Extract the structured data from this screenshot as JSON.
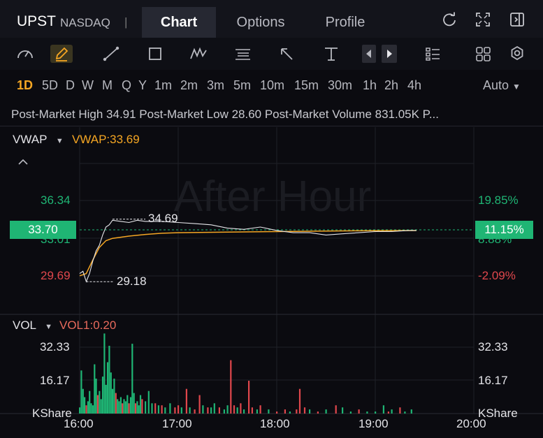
{
  "header": {
    "ticker": "UPST",
    "exchange": "NASDAQ",
    "separator": "|",
    "tabs": [
      {
        "label": "Chart",
        "active": true
      },
      {
        "label": "Options",
        "active": false
      },
      {
        "label": "Profile",
        "active": false
      }
    ]
  },
  "toolbar": {
    "icons": [
      "speedometer-icon",
      "pencil-icon",
      "trendline-icon",
      "rectangle-icon",
      "pattern-icon",
      "fibonacci-icon",
      "arrow-icon",
      "measure-icon",
      "prev-icon",
      "next-icon",
      "layout-icon",
      "grid-icon",
      "settings-icon"
    ]
  },
  "periods": {
    "items": [
      "1D",
      "5D",
      "D",
      "W",
      "M",
      "Q",
      "Y",
      "1m",
      "2m",
      "3m",
      "5m",
      "10m",
      "15m",
      "30m",
      "1h",
      "2h",
      "4h"
    ],
    "active": "1D",
    "mode": "Auto"
  },
  "info_line": "Post-Market High 34.91 Post-Market Low 28.60 Post-Market Volume 831.05K P...",
  "price_pane": {
    "indicator": "VWAP",
    "indicator_value": "VWAP:33.69",
    "watermark": "After Hour",
    "left_ticks": [
      "36.34",
      "33.01",
      "29.69"
    ],
    "right_ticks": [
      "19.85%",
      "8.88%",
      "-2.09%"
    ],
    "current_price": "33.70",
    "current_pct": "11.15%",
    "high_label": "34.69",
    "low_label": "29.18",
    "colors": {
      "up": "#1fb574",
      "down": "#e0474c",
      "vwap": "#f5a623",
      "price_line": "#e6e6ea"
    }
  },
  "volume_pane": {
    "indicator": "VOL",
    "indicator_value": "VOL1:0.20",
    "left_ticks": [
      "32.33",
      "16.17",
      "KShare"
    ],
    "right_ticks": [
      "32.33",
      "16.17",
      "KShare"
    ]
  },
  "x_axis": [
    "16:00",
    "17:00",
    "18:00",
    "19:00",
    "20:00"
  ],
  "chart_data": {
    "type": "line",
    "x_range": [
      "16:00",
      "20:00"
    ],
    "y_range": [
      28.6,
      37.5
    ],
    "price_series": {
      "x": [
        "16:00",
        "16:02",
        "16:04",
        "16:06",
        "16:08",
        "16:10",
        "16:12",
        "16:14",
        "16:16",
        "16:18",
        "16:20",
        "16:25",
        "16:30",
        "16:35",
        "16:40",
        "16:45",
        "16:50",
        "17:00",
        "17:10",
        "17:20",
        "17:30",
        "17:40",
        "17:50",
        "18:00",
        "18:10",
        "18:20",
        "18:30",
        "18:40",
        "18:50",
        "19:00",
        "19:10",
        "19:20",
        "19:25"
      ],
      "values": [
        29.9,
        30.1,
        29.2,
        29.9,
        31.0,
        31.9,
        32.4,
        33.3,
        34.0,
        34.2,
        34.6,
        34.5,
        34.4,
        34.6,
        34.5,
        34.5,
        34.5,
        34.4,
        34.3,
        34.2,
        33.9,
        33.8,
        34.0,
        33.7,
        33.5,
        33.5,
        33.3,
        33.4,
        33.5,
        33.6,
        33.6,
        33.7,
        33.7
      ]
    },
    "vwap_series": {
      "x": [
        "16:00",
        "16:04",
        "16:08",
        "16:12",
        "16:16",
        "16:20",
        "16:30",
        "16:40",
        "16:50",
        "17:00",
        "17:30",
        "18:00",
        "18:30",
        "19:00",
        "19:25"
      ],
      "values": [
        29.7,
        29.9,
        31.1,
        32.2,
        32.8,
        33.0,
        33.2,
        33.35,
        33.45,
        33.5,
        33.55,
        33.6,
        33.65,
        33.68,
        33.69
      ]
    },
    "volume": {
      "unit": "KShare",
      "y_range": [
        0,
        40
      ],
      "bars": [
        {
          "t": "16:00",
          "v": 3,
          "d": "up"
        },
        {
          "t": "16:01",
          "v": 21,
          "d": "up"
        },
        {
          "t": "16:02",
          "v": 12,
          "d": "up"
        },
        {
          "t": "16:03",
          "v": 8,
          "d": "up"
        },
        {
          "t": "16:04",
          "v": 4,
          "d": "down"
        },
        {
          "t": "16:05",
          "v": 6,
          "d": "up"
        },
        {
          "t": "16:06",
          "v": 11,
          "d": "up"
        },
        {
          "t": "16:07",
          "v": 5,
          "d": "up"
        },
        {
          "t": "16:08",
          "v": 4,
          "d": "up"
        },
        {
          "t": "16:09",
          "v": 24,
          "d": "up"
        },
        {
          "t": "16:10",
          "v": 17,
          "d": "up"
        },
        {
          "t": "16:11",
          "v": 9,
          "d": "down"
        },
        {
          "t": "16:12",
          "v": 11,
          "d": "up"
        },
        {
          "t": "16:13",
          "v": 7,
          "d": "up"
        },
        {
          "t": "16:14",
          "v": 18,
          "d": "up"
        },
        {
          "t": "16:15",
          "v": 39,
          "d": "up"
        },
        {
          "t": "16:16",
          "v": 14,
          "d": "up"
        },
        {
          "t": "16:17",
          "v": 25,
          "d": "up"
        },
        {
          "t": "16:18",
          "v": 33,
          "d": "up"
        },
        {
          "t": "16:19",
          "v": 20,
          "d": "up"
        },
        {
          "t": "16:20",
          "v": 12,
          "d": "up"
        },
        {
          "t": "16:21",
          "v": 17,
          "d": "up"
        },
        {
          "t": "16:22",
          "v": 10,
          "d": "down"
        },
        {
          "t": "16:23",
          "v": 7,
          "d": "up"
        },
        {
          "t": "16:24",
          "v": 6,
          "d": "up"
        },
        {
          "t": "16:25",
          "v": 8,
          "d": "up"
        },
        {
          "t": "16:26",
          "v": 5,
          "d": "down"
        },
        {
          "t": "16:27",
          "v": 7,
          "d": "up"
        },
        {
          "t": "16:28",
          "v": 6,
          "d": "up"
        },
        {
          "t": "16:29",
          "v": 9,
          "d": "up"
        },
        {
          "t": "16:30",
          "v": 5,
          "d": "down"
        },
        {
          "t": "16:31",
          "v": 8,
          "d": "up"
        },
        {
          "t": "16:32",
          "v": 34,
          "d": "up"
        },
        {
          "t": "16:33",
          "v": 10,
          "d": "up"
        },
        {
          "t": "16:34",
          "v": 5,
          "d": "down"
        },
        {
          "t": "16:35",
          "v": 6,
          "d": "up"
        },
        {
          "t": "16:36",
          "v": 4,
          "d": "up"
        },
        {
          "t": "16:37",
          "v": 9,
          "d": "up"
        },
        {
          "t": "16:38",
          "v": 7,
          "d": "down"
        },
        {
          "t": "16:40",
          "v": 6,
          "d": "up"
        },
        {
          "t": "16:42",
          "v": 11,
          "d": "up"
        },
        {
          "t": "16:44",
          "v": 5,
          "d": "up"
        },
        {
          "t": "16:46",
          "v": 5,
          "d": "down"
        },
        {
          "t": "16:48",
          "v": 4,
          "d": "up"
        },
        {
          "t": "16:50",
          "v": 4,
          "d": "down"
        },
        {
          "t": "16:52",
          "v": 3,
          "d": "up"
        },
        {
          "t": "16:55",
          "v": 5,
          "d": "up"
        },
        {
          "t": "16:58",
          "v": 3,
          "d": "down"
        },
        {
          "t": "17:00",
          "v": 4,
          "d": "down"
        },
        {
          "t": "17:02",
          "v": 3,
          "d": "up"
        },
        {
          "t": "17:05",
          "v": 12,
          "d": "down"
        },
        {
          "t": "17:07",
          "v": 3,
          "d": "up"
        },
        {
          "t": "17:10",
          "v": 2,
          "d": "down"
        },
        {
          "t": "17:13",
          "v": 9,
          "d": "down"
        },
        {
          "t": "17:15",
          "v": 4,
          "d": "up"
        },
        {
          "t": "17:18",
          "v": 3,
          "d": "down"
        },
        {
          "t": "17:20",
          "v": 3,
          "d": "up"
        },
        {
          "t": "17:22",
          "v": 5,
          "d": "up"
        },
        {
          "t": "17:25",
          "v": 3,
          "d": "down"
        },
        {
          "t": "17:28",
          "v": 2,
          "d": "up"
        },
        {
          "t": "17:30",
          "v": 4,
          "d": "up"
        },
        {
          "t": "17:32",
          "v": 26,
          "d": "down"
        },
        {
          "t": "17:34",
          "v": 4,
          "d": "down"
        },
        {
          "t": "17:36",
          "v": 3,
          "d": "up"
        },
        {
          "t": "17:38",
          "v": 5,
          "d": "down"
        },
        {
          "t": "17:40",
          "v": 2,
          "d": "up"
        },
        {
          "t": "17:43",
          "v": 16,
          "d": "down"
        },
        {
          "t": "17:45",
          "v": 3,
          "d": "down"
        },
        {
          "t": "17:48",
          "v": 2,
          "d": "up"
        },
        {
          "t": "17:50",
          "v": 4,
          "d": "down"
        },
        {
          "t": "17:55",
          "v": 2,
          "d": "up"
        },
        {
          "t": "18:00",
          "v": 1,
          "d": "down"
        },
        {
          "t": "18:05",
          "v": 2,
          "d": "down"
        },
        {
          "t": "18:08",
          "v": 1,
          "d": "up"
        },
        {
          "t": "18:12",
          "v": 2,
          "d": "down"
        },
        {
          "t": "18:14",
          "v": 12,
          "d": "down"
        },
        {
          "t": "18:17",
          "v": 3,
          "d": "down"
        },
        {
          "t": "18:20",
          "v": 2,
          "d": "up"
        },
        {
          "t": "18:25",
          "v": 1,
          "d": "down"
        },
        {
          "t": "18:30",
          "v": 2,
          "d": "up"
        },
        {
          "t": "18:36",
          "v": 4,
          "d": "down"
        },
        {
          "t": "18:40",
          "v": 3,
          "d": "up"
        },
        {
          "t": "18:45",
          "v": 1,
          "d": "up"
        },
        {
          "t": "18:50",
          "v": 2,
          "d": "down"
        },
        {
          "t": "18:55",
          "v": 1,
          "d": "up"
        },
        {
          "t": "19:00",
          "v": 1,
          "d": "up"
        },
        {
          "t": "19:05",
          "v": 4,
          "d": "up"
        },
        {
          "t": "19:08",
          "v": 1,
          "d": "down"
        },
        {
          "t": "19:10",
          "v": 2,
          "d": "up"
        },
        {
          "t": "19:15",
          "v": 3,
          "d": "down"
        },
        {
          "t": "19:18",
          "v": 1,
          "d": "up"
        },
        {
          "t": "19:22",
          "v": 2,
          "d": "up"
        }
      ]
    }
  }
}
